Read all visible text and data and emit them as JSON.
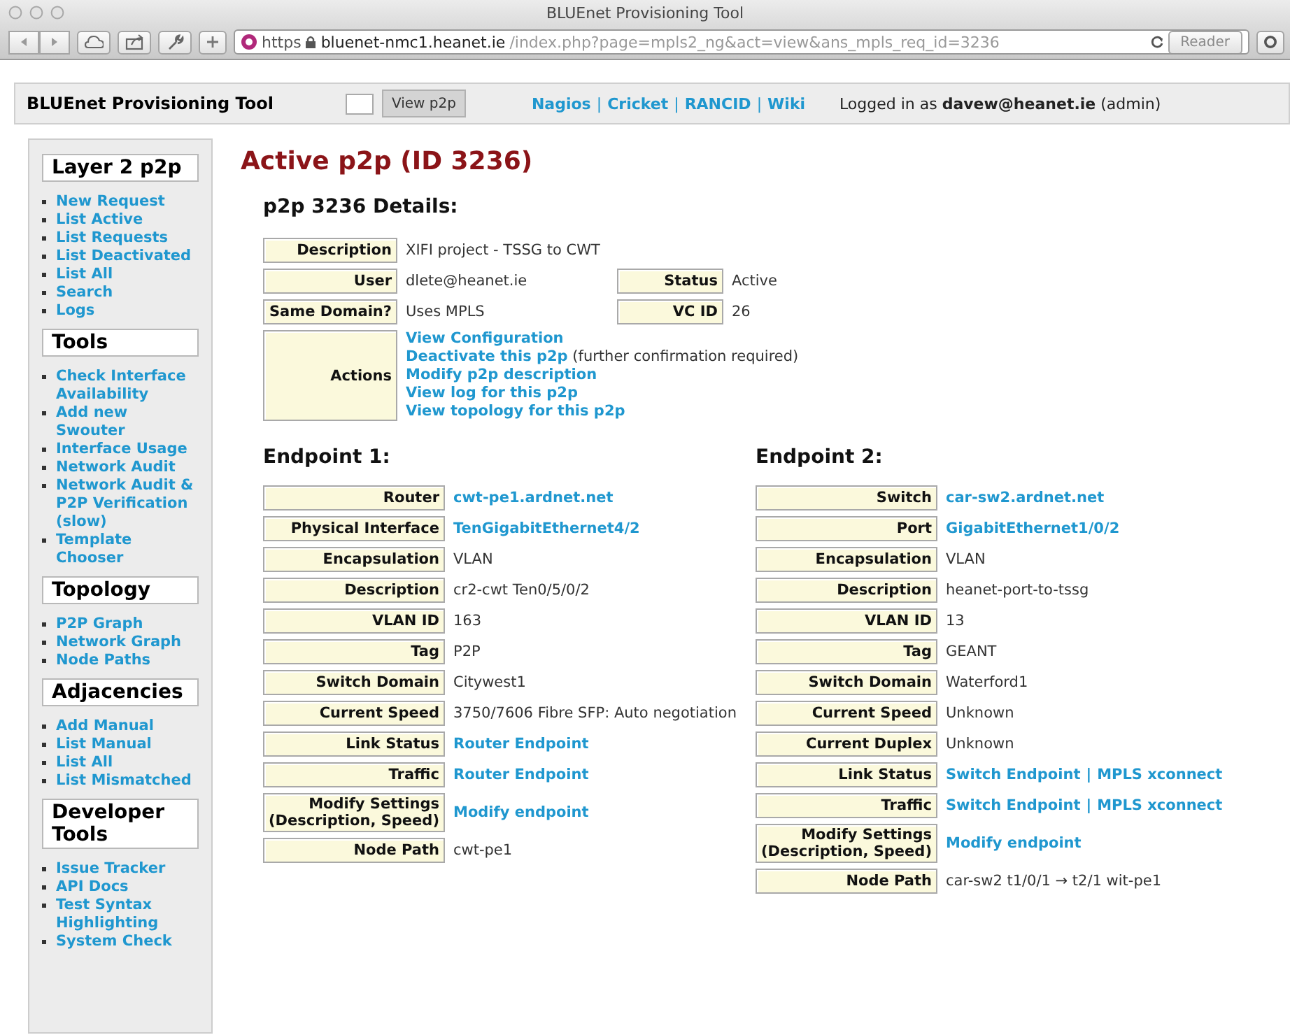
{
  "window": {
    "title": "BLUEnet Provisioning Tool"
  },
  "toolbar": {
    "scheme": "https",
    "host": "bluenet-nmc1.heanet.ie",
    "path": "/index.php?page=mpls2_ng&act=view&ans_mpls_req_id=3236",
    "reader": {
      "label": "Reader",
      "disabled": true
    }
  },
  "topbar": {
    "title": "BLUEnet Provisioning Tool",
    "button": "View p2p",
    "links": [
      "Nagios",
      "Cricket",
      "RANCID",
      "Wiki"
    ],
    "separator": "|",
    "login": "Logged in as **davew@heanet.ie** (admin)"
  },
  "sidebar": {
    "sections": [
      {
        "title": "Layer 2 p2p",
        "items": [
          "New Request",
          "List Active",
          "List Requests",
          "List Deactivated",
          "List All",
          "Search",
          "Logs"
        ]
      },
      {
        "title": "Tools",
        "items": [
          "Check Interface Availability",
          "Add new Swouter",
          "Interface Usage",
          "Network Audit",
          "Network Audit & P2P Verification (slow)",
          "Template Chooser"
        ]
      },
      {
        "title": "Topology",
        "items": [
          "P2P Graph",
          "Network Graph",
          "Node Paths"
        ]
      },
      {
        "title": "Adjacencies",
        "items": [
          "Add Manual",
          "List Manual",
          "List All",
          "List Mismatched"
        ]
      },
      {
        "title": "Developer Tools",
        "items": [
          "Issue Tracker",
          "API Docs",
          "Test Syntax Highlighting",
          "System Check"
        ]
      }
    ]
  },
  "main": {
    "heading": "Active p2p (ID 3236)",
    "details": {
      "title": "p2p 3236 Details:",
      "description": {
        "label": "Description",
        "value": "XIFI project - TSSG to CWT"
      },
      "pairs": [
        [
          {
            "label": "User",
            "value": "dlete@heanet.ie"
          },
          {
            "label": "Status",
            "value": "Active"
          }
        ],
        [
          {
            "label": "Same Domain?",
            "value": "Uses MPLS"
          },
          {
            "label": "VC ID",
            "value": "26"
          }
        ]
      ],
      "actions": {
        "label": "Actions",
        "items": [
          {
            "link": "View Configuration"
          },
          {
            "link": "Deactivate this p2p",
            "note": "(further confirmation required)"
          },
          {
            "link": "Modify p2p description"
          },
          {
            "link": "View log for this p2p"
          },
          {
            "link": "View topology for this p2p"
          }
        ]
      }
    },
    "endpoints": [
      {
        "title": "Endpoint 1:",
        "rows": [
          {
            "label": "Router",
            "kind": "link",
            "value": "cwt-pe1.ardnet.net"
          },
          {
            "label": "Physical Interface",
            "kind": "link",
            "value": "TenGigabitEthernet4/2"
          },
          {
            "label": "Encapsulation",
            "kind": "text",
            "value": "VLAN"
          },
          {
            "label": "Description",
            "kind": "text",
            "value": "cr2-cwt Ten0/5/0/2"
          },
          {
            "label": "VLAN ID",
            "kind": "text",
            "value": "163"
          },
          {
            "label": "Tag",
            "kind": "text",
            "value": "P2P"
          },
          {
            "label": "Switch Domain",
            "kind": "text",
            "value": "Citywest1"
          },
          {
            "label": "Current Speed",
            "kind": "text",
            "value": "3750/7606 Fibre SFP: Auto negotiation"
          },
          {
            "label": "Link Status",
            "kind": "link",
            "value": "Router Endpoint"
          },
          {
            "label": "Traffic",
            "kind": "link",
            "value": "Router Endpoint"
          },
          {
            "label": "Modify Settings (Description, Speed)",
            "kind": "link",
            "value": "Modify endpoint"
          },
          {
            "label": "Node Path",
            "kind": "text",
            "value": "cwt-pe1"
          }
        ]
      },
      {
        "title": "Endpoint 2:",
        "rows": [
          {
            "label": "Switch",
            "kind": "link",
            "value": "car-sw2.ardnet.net"
          },
          {
            "label": "Port",
            "kind": "link",
            "value": "GigabitEthernet1/0/2"
          },
          {
            "label": "Encapsulation",
            "kind": "text",
            "value": "VLAN"
          },
          {
            "label": "Description",
            "kind": "text",
            "value": "heanet-port-to-tssg"
          },
          {
            "label": "VLAN ID",
            "kind": "text",
            "value": "13"
          },
          {
            "label": "Tag",
            "kind": "text",
            "value": "GEANT"
          },
          {
            "label": "Switch Domain",
            "kind": "text",
            "value": "Waterford1"
          },
          {
            "label": "Current Speed",
            "kind": "text",
            "value": "Unknown"
          },
          {
            "label": "Current Duplex",
            "kind": "text",
            "value": "Unknown"
          },
          {
            "label": "Link Status",
            "kind": "links",
            "links": [
              "Switch Endpoint",
              "MPLS xconnect"
            ],
            "separator": "|"
          },
          {
            "label": "Traffic",
            "kind": "links",
            "links": [
              "Switch Endpoint",
              "MPLS xconnect"
            ],
            "separator": "|"
          },
          {
            "label": "Modify Settings (Description, Speed)",
            "kind": "link",
            "value": "Modify endpoint"
          },
          {
            "label": "Node Path",
            "kind": "text",
            "value": "car-sw2 t1/0/1 → t2/1 wit-pe1"
          }
        ]
      }
    ]
  }
}
